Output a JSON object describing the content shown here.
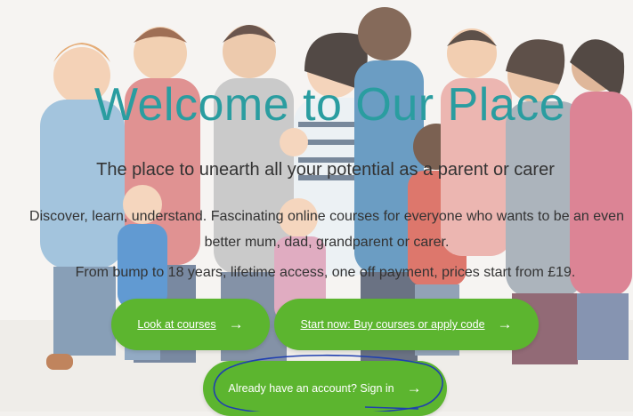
{
  "hero": {
    "title": "Welcome to Our Place",
    "subtitle": "The place to unearth all your potential as a parent or carer",
    "description": "Discover, learn, understand. Fascinating online courses for everyone who wants to be an even better mum, dad, grandparent or carer.",
    "pricing": "From bump to 18 years, lifetime access, one off payment, prices start from £19."
  },
  "buttons": {
    "courses": "Look at courses",
    "start": "Start now: Buy courses or apply code",
    "signin": "Already have an account? Sign in"
  },
  "icons": {
    "arrow": "→"
  },
  "colors": {
    "accent": "#5cb52f",
    "title": "#2a9da0",
    "annotation": "#1f3fb0"
  }
}
